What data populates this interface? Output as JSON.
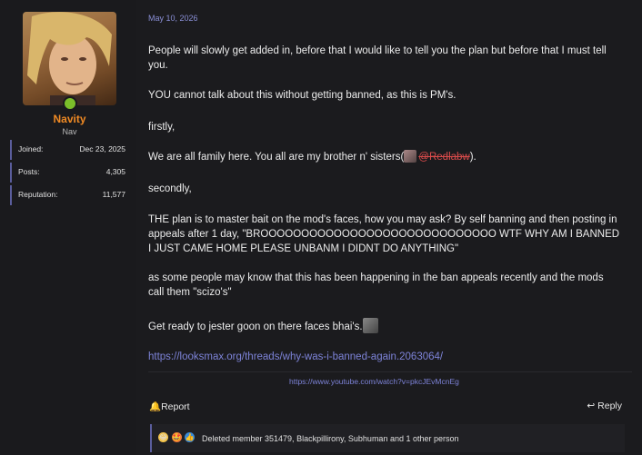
{
  "user": {
    "name": "Navity",
    "title": "Nav",
    "stats": [
      {
        "label": "Joined:",
        "value": "Dec 23, 2025"
      },
      {
        "label": "Posts:",
        "value": "4,305"
      },
      {
        "label": "Reputation:",
        "value": "11,577"
      }
    ]
  },
  "post": {
    "date": "May 10, 2026",
    "p1": "People will slowly get added in, before that I would like to tell you the plan but before that I must tell you.",
    "p2": "YOU cannot talk about this without getting banned, as this is PM's.",
    "p3": "firstly,",
    "p4_before": "We are all family here. You all are my brother n' sisters(",
    "p4_mention": "@Redlabw",
    "p4_after": ").",
    "p5": "secondly,",
    "p6": "THE plan is to master bait on the mod's faces, how you may ask? By self banning and then posting in appeals after 1 day, \"BROOOOOOOOOOOOOOOOOOOOOOOOOOOOO WTF WHY AM I BANNED I JUST CAME HOME PLEASE UNBANM I DIDNT DO ANYTHING\"",
    "p7": "as some people may know that this has been happening in the ban appeals recently and the mods call them \"scizo's\"",
    "p8": "Get ready to jester goon on there faces bhai's.",
    "link": "https://looksmax.org/threads/why-was-i-banned-again.2063064/",
    "signature_link": "https://www.youtube.com/watch?v=pkcJEvMcnEg"
  },
  "actions": {
    "report": "Report",
    "reply": "Reply"
  },
  "reactions": {
    "text": "Deleted member 351479, Blackpillirony, Subhuman and 1 other person"
  },
  "colors": {
    "username": "#f08a24",
    "link": "#7d83d8",
    "online": "#7bbf2a"
  }
}
